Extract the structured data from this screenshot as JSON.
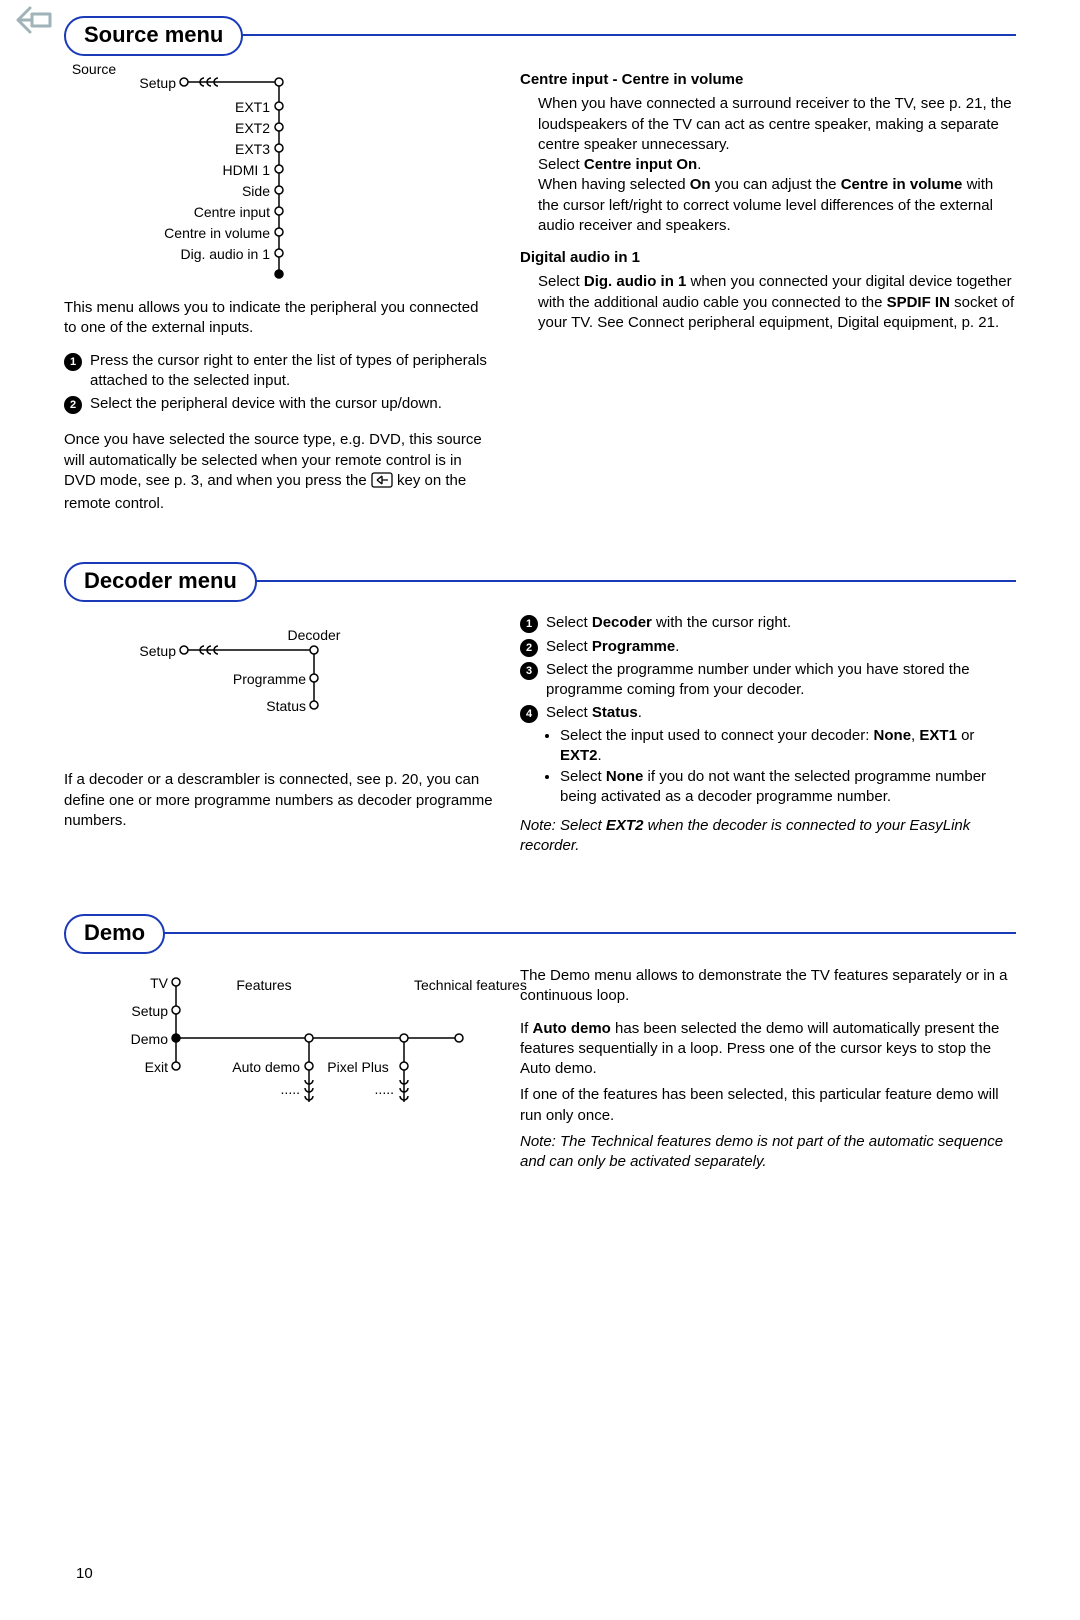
{
  "page_number": "10",
  "sections": {
    "source": {
      "title": "Source menu",
      "diagram": {
        "root": "Setup",
        "branch": "Source",
        "items": [
          "EXT1",
          "EXT2",
          "EXT3",
          "HDMI 1",
          "Side",
          "Centre input",
          "Centre in volume",
          "Dig. audio in 1"
        ]
      },
      "intro": "This menu allows you to indicate the peripheral you connected to one of the external inputs.",
      "steps": [
        "Press the cursor right to enter the list of types of peripherals attached to the selected input.",
        "Select the peripheral device with the cursor up/down."
      ],
      "after_a": "Once you have selected the source type, e.g. DVD, this source will automatically be selected when your remote control is in DVD mode, see p. 3, and when you press the ",
      "after_b": " key on the remote control.",
      "right": {
        "h1": "Centre input - Centre in volume",
        "p1a": "When you have connected a surround receiver to the TV,  see p. 21, the loudspeakers of the TV can act as centre speaker, making a separate centre speaker unnecessary.",
        "p1b_pre": "Select ",
        "p1b_bold": "Centre input On",
        "p1b_post": ".",
        "p1c_a": "When having selected ",
        "p1c_b": "On",
        "p1c_c": " you can adjust the ",
        "p1c_d": "Centre in volume",
        "p1c_e": " with the cursor left/right to correct volume level differences of the external audio receiver and speakers.",
        "h2": "Digital audio in 1",
        "p2a": "Select ",
        "p2b": "Dig. audio in 1",
        "p2c": " when you connected your digital device together with the additional audio cable you connected to the ",
        "p2d": "SPDIF IN",
        "p2e": " socket of your TV. See Connect peripheral equipment, Digital equipment, p. 21."
      }
    },
    "decoder": {
      "title": "Decoder menu",
      "diagram": {
        "root": "Setup",
        "branch": "Decoder",
        "items": [
          "Programme",
          "Status"
        ]
      },
      "left_p": "If a decoder or a descrambler is connected, see p. 20, you can define one or more programme numbers as decoder programme numbers.",
      "steps": [
        {
          "pre": "Select ",
          "bold": "Decoder",
          "post": " with the cursor right."
        },
        {
          "pre": "Select ",
          "bold": "Programme",
          "post": "."
        },
        {
          "plain": "Select the programme number under which you have stored the programme coming from your decoder."
        },
        {
          "pre": "Select ",
          "bold": "Status",
          "post": "."
        }
      ],
      "sub_bullets": [
        {
          "a": "Select the input used to connect your decoder: ",
          "b1": "None",
          "m1": ", ",
          "b2": "EXT1",
          "m2": " or ",
          "b3": "EXT2",
          "end": "."
        },
        {
          "a": "Select ",
          "b1": "None",
          "m1": " if you do not want the selected programme number being activated as a decoder programme number."
        }
      ],
      "note_a": "Note: Select ",
      "note_b": "EXT2",
      "note_c": " when the decoder is connected to your EasyLink recorder."
    },
    "demo": {
      "title": "Demo",
      "diagram": {
        "left": [
          "TV",
          "Setup",
          "Demo",
          "Exit"
        ],
        "col1_head": "Features",
        "col1_items": [
          "Auto demo",
          "....."
        ],
        "col2_head": "Technical features",
        "col2_items": [
          "Pixel Plus",
          "....."
        ]
      },
      "p1": "The Demo menu allows to demonstrate the TV features separately or in a continuous loop.",
      "p2a": "If ",
      "p2b": "Auto demo",
      "p2c": " has been selected the demo will automatically present the features sequentially in a loop. Press one of the cursor keys to stop the Auto demo.",
      "p3": "If one of the features has been selected, this particular feature demo will run only once.",
      "note": "Note: The Technical features demo is not part of the automatic sequence and can only be activated separately."
    }
  }
}
